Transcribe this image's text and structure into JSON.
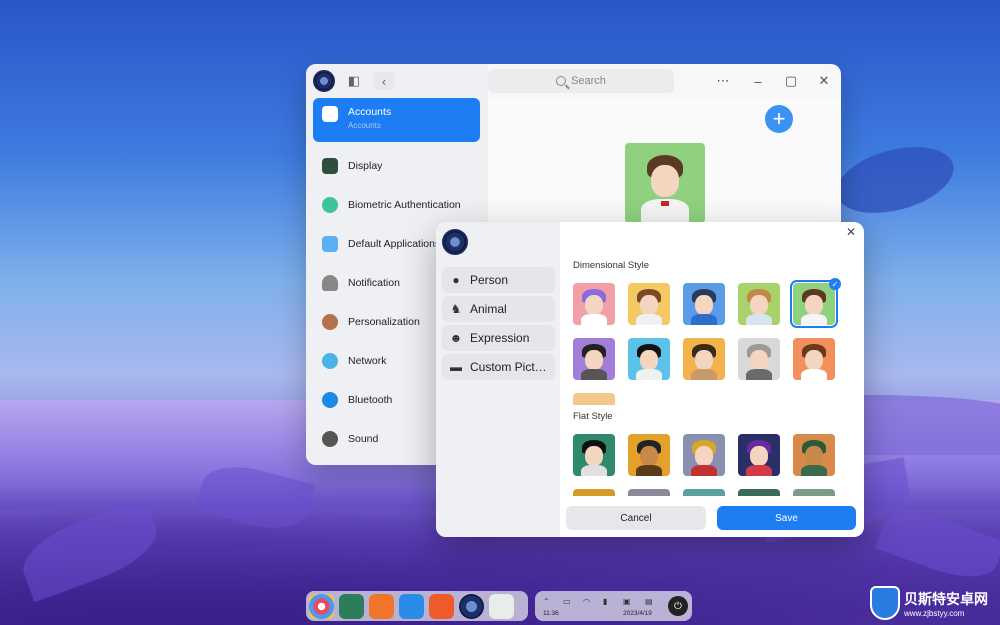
{
  "colors": {
    "accent": "#1c7ef2",
    "window_bg": "#f7f7f8",
    "sidebar_bg": "#eef0f3"
  },
  "settings": {
    "search_placeholder": "Search",
    "nav": [
      {
        "label": "Accounts",
        "sublabel": "Accounts",
        "icon": "accounts-icon",
        "active": true
      },
      {
        "label": "Display",
        "icon": "display-icon"
      },
      {
        "label": "Biometric Authentication",
        "icon": "biometric-icon"
      },
      {
        "label": "Default Applications",
        "icon": "default-apps-icon"
      },
      {
        "label": "Notification",
        "icon": "notification-bell-icon"
      },
      {
        "label": "Personalization",
        "icon": "personalization-icon"
      },
      {
        "label": "Network",
        "icon": "network-icon"
      },
      {
        "label": "Bluetooth",
        "icon": "bluetooth-icon"
      },
      {
        "label": "Sound",
        "icon": "sound-icon"
      }
    ]
  },
  "avatar_dialog": {
    "categories": [
      {
        "label": "Person",
        "icon": "person-icon"
      },
      {
        "label": "Animal",
        "icon": "animal-icon"
      },
      {
        "label": "Expression",
        "icon": "expression-icon"
      },
      {
        "label": "Custom Pict…",
        "icon": "folder-icon"
      }
    ],
    "dimensional_title": "Dimensional Style",
    "flat_title": "Flat Style",
    "cancel_label": "Cancel",
    "save_label": "Save"
  },
  "tray": {
    "time": "11:36",
    "date": "2023/4/19"
  },
  "watermark": {
    "name": "贝斯特安卓网",
    "url": "www.zjbstyy.com"
  }
}
